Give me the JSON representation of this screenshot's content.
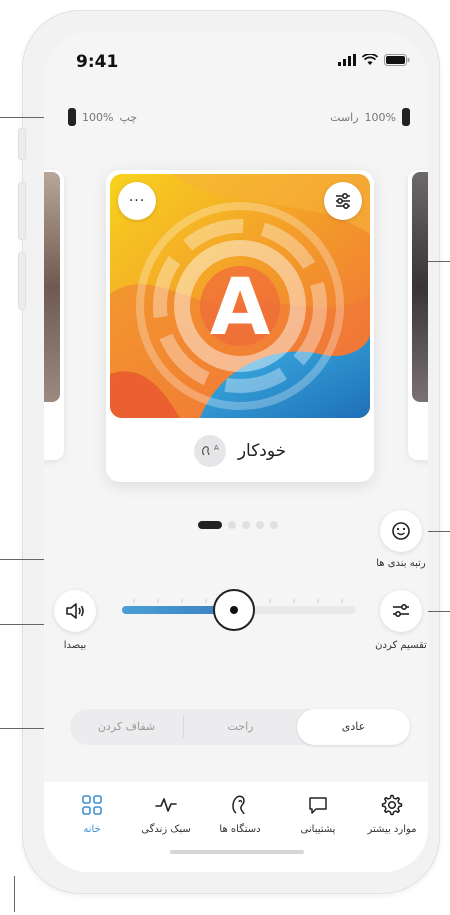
{
  "status_bar": {
    "time": "9:41"
  },
  "battery": {
    "left_label": "چپ",
    "left_value": "100%",
    "right_label": "راست",
    "right_value": "100%"
  },
  "program_card": {
    "letter": "A",
    "name": "خودکار",
    "more_icon": "ellipsis-icon",
    "settings_icon": "sliders-icon",
    "badge_icon": "ear-a-icon"
  },
  "pager": {
    "count": 5,
    "active_index": 0
  },
  "controls": {
    "rating_label": "رتبه بندی ها",
    "mute_label": "بیصدا",
    "split_label": "تقسیم کردن",
    "volume_level": 0.48
  },
  "sound_mode": {
    "options": [
      "شفاف کردن",
      "راحت",
      "عادی"
    ],
    "selected": "عادی"
  },
  "tabs": [
    {
      "label": "موارد بیشتر",
      "icon": "gear-icon"
    },
    {
      "label": "پشتیبانی",
      "icon": "chat-icon"
    },
    {
      "label": "دستگاه ها",
      "icon": "hearing-aid-icon"
    },
    {
      "label": "سبک زندگی",
      "icon": "pulse-icon"
    },
    {
      "label": "خانه",
      "icon": "grid-icon"
    }
  ],
  "colors": {
    "accent": "#3a8fd0",
    "text": "#222222"
  }
}
